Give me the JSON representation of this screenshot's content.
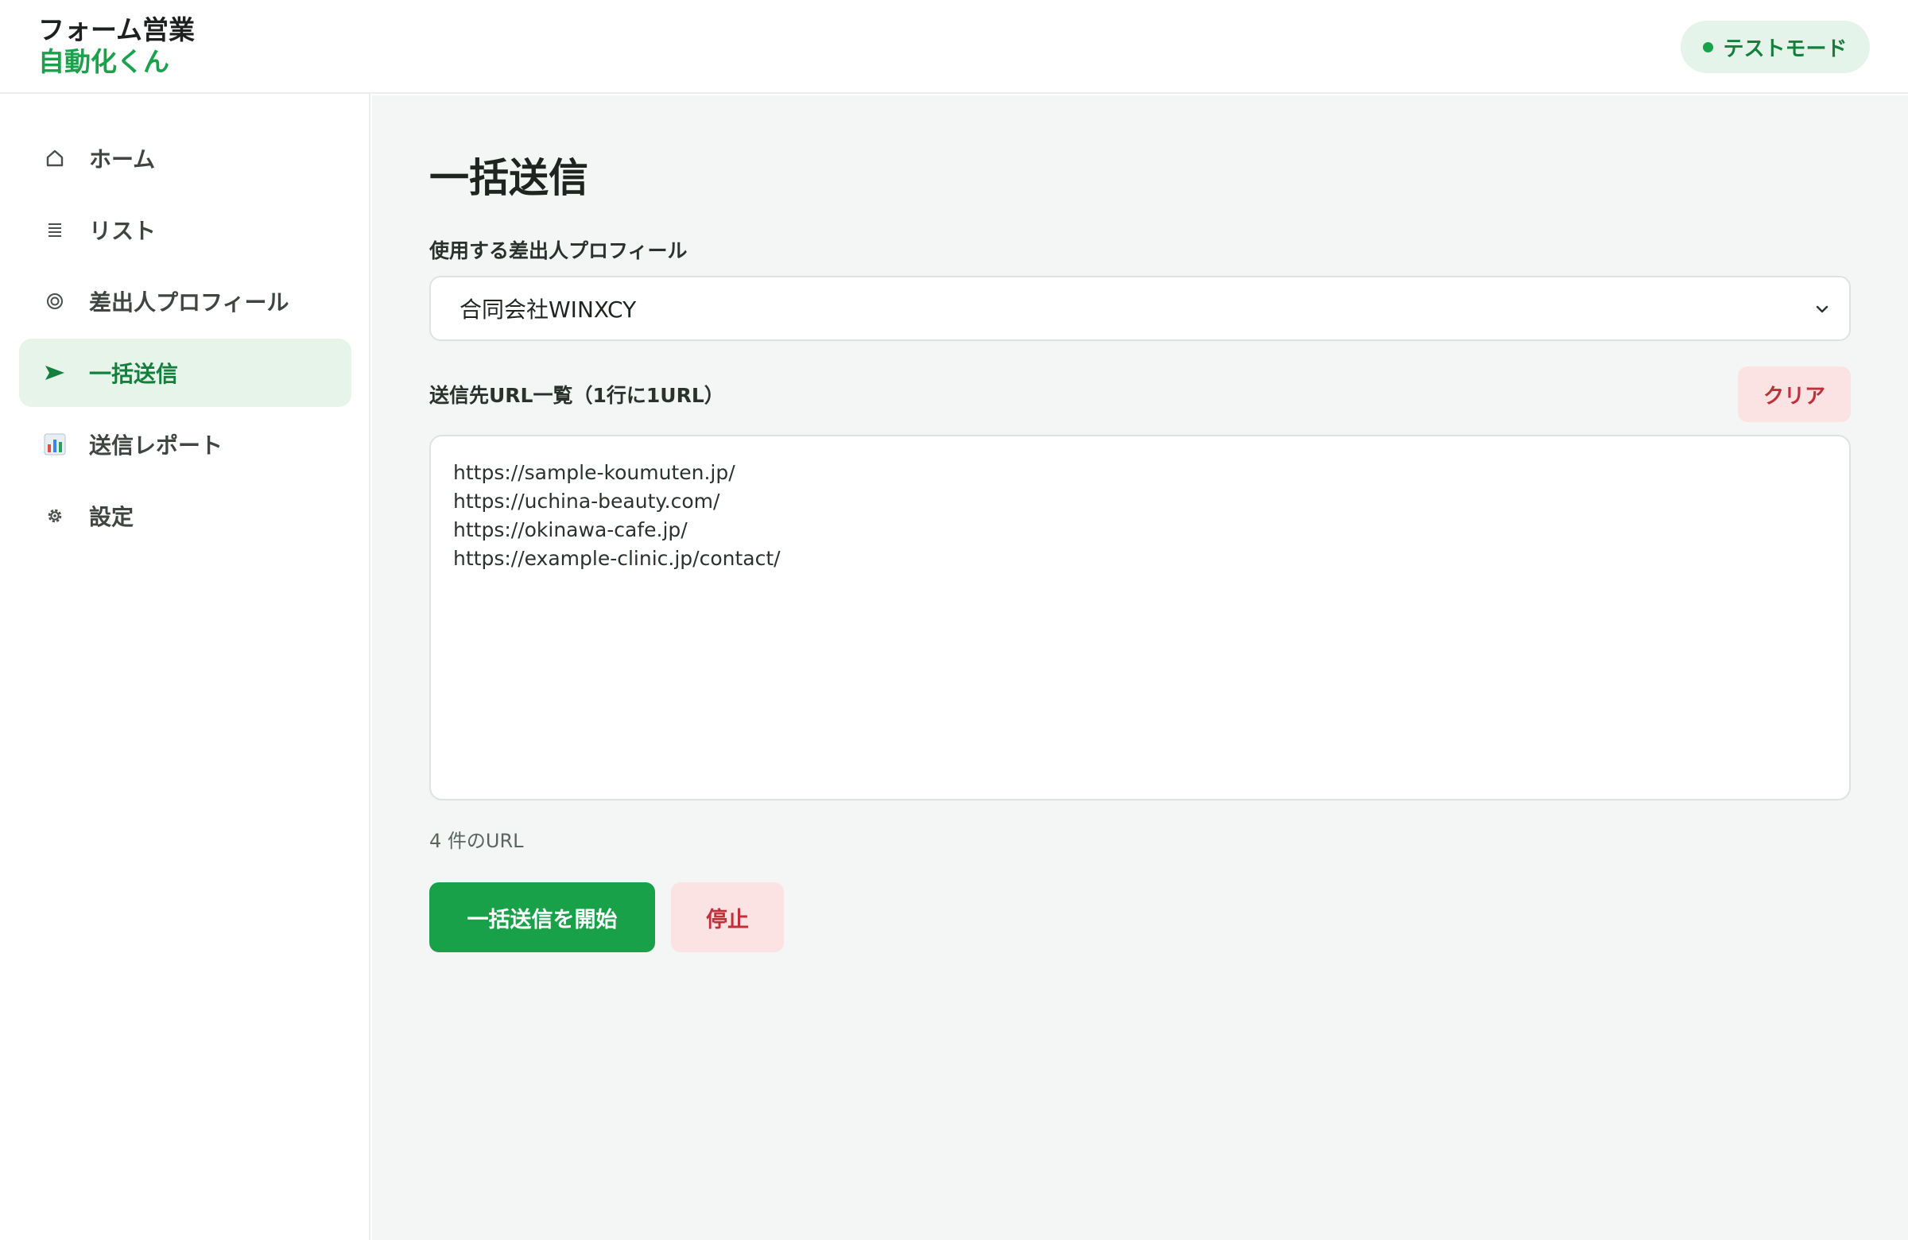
{
  "app": {
    "logo_line1": "フォーム営業",
    "logo_line2": "自動化くん",
    "mode_badge": "テストモード"
  },
  "sidebar": {
    "items": [
      {
        "label": "ホーム",
        "icon": "home-icon"
      },
      {
        "label": "リスト",
        "icon": "list-icon"
      },
      {
        "label": "差出人プロフィール",
        "icon": "profile-icon"
      },
      {
        "label": "一括送信",
        "icon": "send-icon",
        "active": true
      },
      {
        "label": "送信レポート",
        "icon": "bar-chart-icon"
      },
      {
        "label": "設定",
        "icon": "gear-icon"
      }
    ]
  },
  "main": {
    "title": "一括送信",
    "profile_label": "使用する差出人プロフィール",
    "profile_selected": "合同会社WINXCY",
    "urls_label": "送信先URL一覧（1行に1URL）",
    "clear_label": "クリア",
    "urls": [
      "https://sample-koumuten.jp/",
      "https://uchina-beauty.com/",
      "https://okinawa-cafe.jp/",
      "https://example-clinic.jp/contact/"
    ],
    "url_count": "4 件のURL",
    "start_label": "一括送信を開始",
    "stop_label": "停止"
  },
  "colors": {
    "accent": "#18a148",
    "accent_light": "#e6f4ea",
    "danger": "#c0303a",
    "danger_light": "#fbe3e3",
    "main_bg": "#f4f6f5"
  }
}
